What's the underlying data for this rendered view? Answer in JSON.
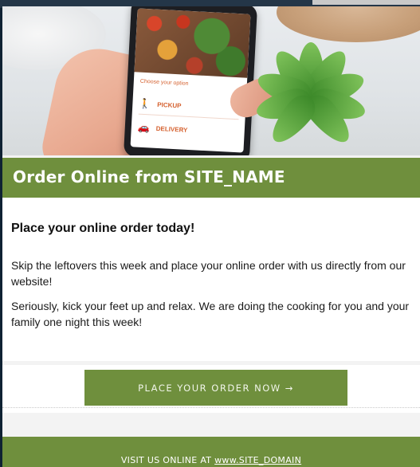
{
  "hero": {
    "app_screen": {
      "choose_label": "Choose your option",
      "pickup_label": "PICKUP",
      "delivery_label": "DELIVERY"
    }
  },
  "header": {
    "title": "Order Online from SITE_NAME"
  },
  "content": {
    "heading": "Place your online order today!",
    "paragraph_1": "Skip the leftovers this week and place your online order with us directly from our website!",
    "paragraph_2": "Seriously, kick your feet up and relax. We are doing the cooking for you and your family one night this week!"
  },
  "cta": {
    "label": "PLACE YOUR ORDER NOW →"
  },
  "footer": {
    "prefix": "VISIT US ONLINE AT ",
    "link_text": "www.SITE_DOMAIN"
  },
  "colors": {
    "brand_green": "#6f8f3d",
    "accent_orange": "#d5612f",
    "backdrop": "#0f2233"
  }
}
